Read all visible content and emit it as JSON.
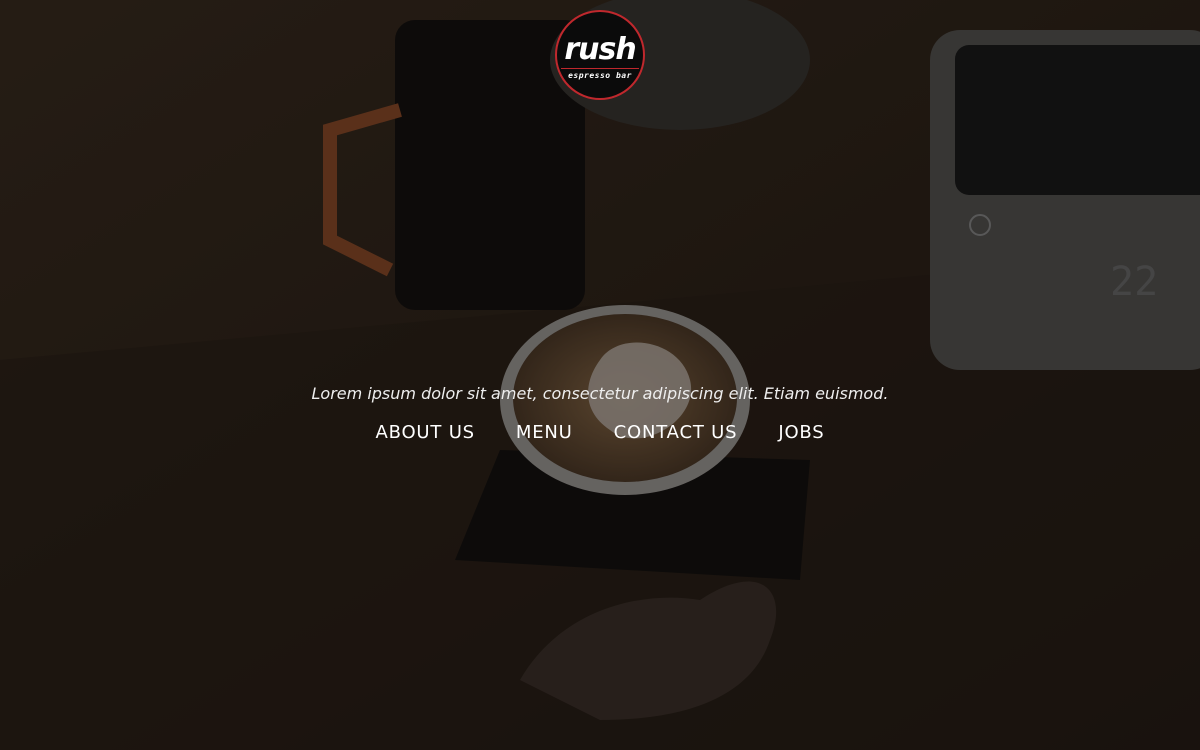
{
  "brand": {
    "name": "rush",
    "subtitle": "espresso bar",
    "accent_color": "#c0282d",
    "logo_background": "#0b0b0b"
  },
  "hero": {
    "tagline": "Lorem ipsum dolor sit amet, consectetur adipiscing elit. Etiam euismod.",
    "background_description_icon": "coffee-photo-background"
  },
  "nav": {
    "items": [
      {
        "label": "ABOUT US"
      },
      {
        "label": "MENU"
      },
      {
        "label": "CONTACT US"
      },
      {
        "label": "JOBS"
      }
    ]
  },
  "colors": {
    "text": "#ffffff",
    "tagline_text": "#eeeeee"
  }
}
